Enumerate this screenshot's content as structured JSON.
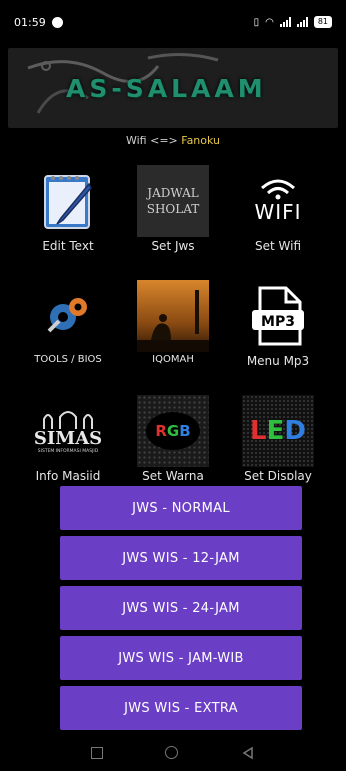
{
  "status": {
    "time": "01:59",
    "battery": "81"
  },
  "banner": {
    "title": "AS-SALAAM"
  },
  "wifi": {
    "prefix": "Wifi <=> ",
    "ssid": "Fanoku"
  },
  "grid": [
    {
      "label": "Edit Text",
      "icon": "notepad-pen-icon"
    },
    {
      "label": "Set Jws",
      "icon": "jadwal-sholat-icon",
      "icon_text_1": "JADWAL",
      "icon_text_2": "SHOLAT"
    },
    {
      "label": "Set Wifi",
      "icon": "wifi-icon",
      "icon_text": "WIFI"
    },
    {
      "label": "TOOLS / BIOS",
      "icon": "gears-icon"
    },
    {
      "label": "IQOMAH",
      "icon": "prayer-silhouette-icon"
    },
    {
      "label": "Menu Mp3",
      "icon": "mp3-file-icon",
      "icon_text": "MP3"
    },
    {
      "label": "Info Masjid",
      "icon": "simas-logo-icon",
      "icon_text": "SIMAS",
      "icon_subtext": "SISTEM INFORMASI MASJID"
    },
    {
      "label": "Set Warna",
      "icon": "rgb-icon",
      "icon_text": "RGB"
    },
    {
      "label": "Set Display",
      "icon": "led-icon",
      "icon_text": "LED"
    }
  ],
  "menu": [
    "JWS - NORMAL",
    "JWS WIS - 12-JAM",
    "JWS WIS - 24-JAM",
    "JWS WIS - JAM-WIB",
    "JWS WIS - EXTRA"
  ],
  "colors": {
    "button": "#6b3fc5",
    "ssid": "#e3c64a",
    "banner_text": "#1f8f6e"
  }
}
